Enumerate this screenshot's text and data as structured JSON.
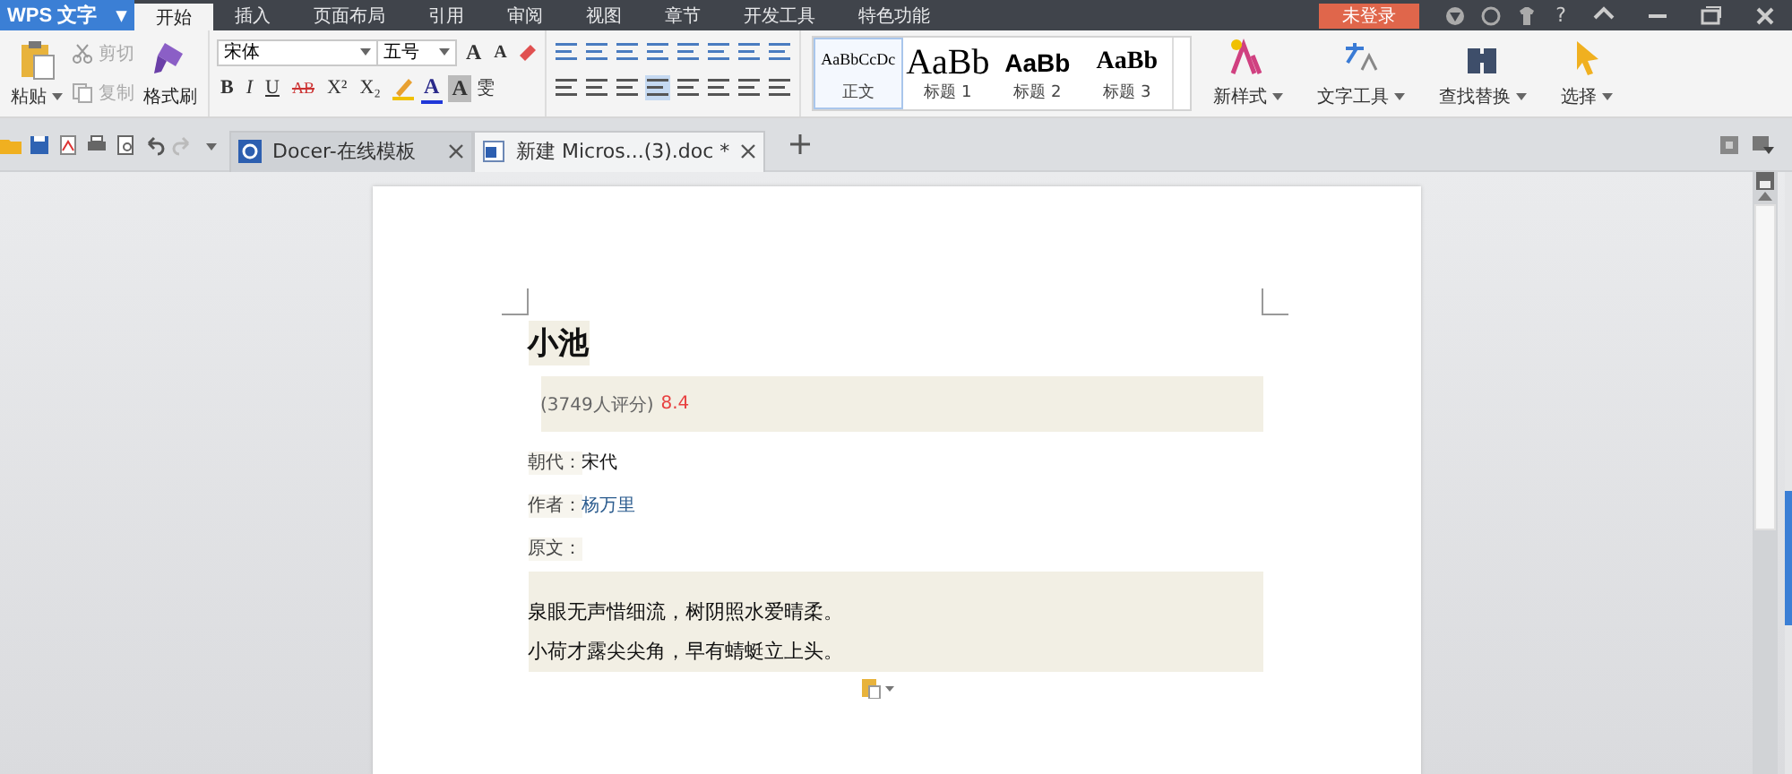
{
  "app_menu": {
    "label": "WPS 文字",
    "arrow": "▾"
  },
  "menu_tabs": [
    {
      "label": "开始",
      "selected": true
    },
    {
      "label": "插入",
      "selected": false
    },
    {
      "label": "页面布局",
      "selected": false
    },
    {
      "label": "引用",
      "selected": false
    },
    {
      "label": "审阅",
      "selected": false
    },
    {
      "label": "视图",
      "selected": false
    },
    {
      "label": "章节",
      "selected": false
    },
    {
      "label": "开发工具",
      "selected": false
    },
    {
      "label": "特色功能",
      "selected": false
    }
  ],
  "login_button": "未登录",
  "help_label": "?",
  "clipboard": {
    "paste": "粘贴",
    "cut": {
      "label": "剪切",
      "disabled": true
    },
    "copy": {
      "label": "复制",
      "disabled": true
    },
    "format_painter": "格式刷"
  },
  "font": {
    "name": "宋体",
    "size": "五号",
    "format_buttons": [
      "B",
      "I",
      "U",
      "AB",
      "X²",
      "X₂"
    ],
    "font_color_label": "A",
    "shade_label": "A",
    "pinyin_label": "雯",
    "grow_label": "A",
    "shrink_label": "A"
  },
  "styles": [
    {
      "preview": "AaBbCcDc",
      "label": "正文",
      "selected": true,
      "kind": "body"
    },
    {
      "preview": "AaBb",
      "label": "标题 1",
      "selected": false,
      "kind": "h1"
    },
    {
      "preview": "AaBb",
      "label": "标题 2",
      "selected": false,
      "kind": "h2"
    },
    {
      "preview": "AaBb",
      "label": "标题 3",
      "selected": false,
      "kind": "h3"
    }
  ],
  "tools": [
    {
      "label": "新样式",
      "kind": "newstyle"
    },
    {
      "label": "文字工具",
      "kind": "texttool"
    },
    {
      "label": "查找替换",
      "kind": "find"
    },
    {
      "label": "选择",
      "kind": "select"
    }
  ],
  "doc_tabs": [
    {
      "label": "Docer-在线模板",
      "selected": false,
      "kind": "docer"
    },
    {
      "label": "新建 Micros...(3).doc *",
      "selected": true,
      "kind": "doc"
    }
  ],
  "document": {
    "title": "小池",
    "rating": {
      "count": "(3749人评分)",
      "score": "8.4"
    },
    "fields": [
      {
        "label": "朝代：",
        "value": "宋代",
        "kind": "plain"
      },
      {
        "label": "作者：",
        "value": "杨万里",
        "kind": "link"
      },
      {
        "label": "原文：",
        "kind": "plain"
      }
    ],
    "poem": [
      "泉眼无声惜细流，树阴照水爱晴柔。",
      "小荷才露尖尖角，早有蜻蜓立上头。"
    ]
  }
}
